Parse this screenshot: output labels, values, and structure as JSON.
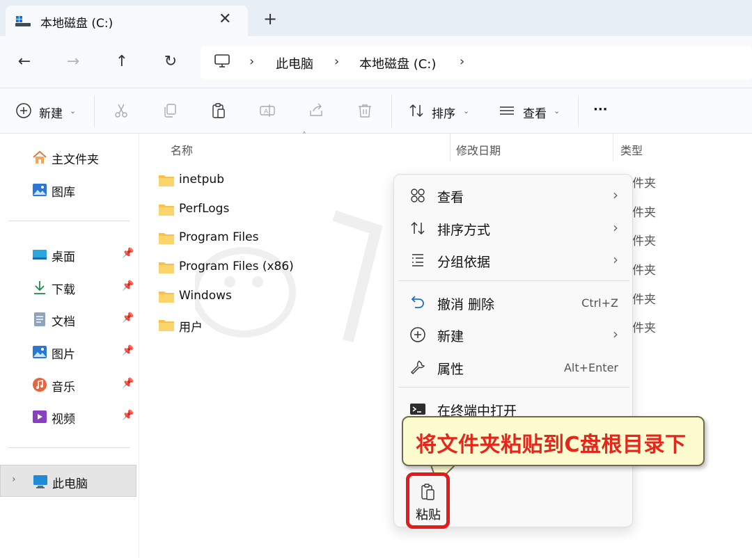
{
  "tab": {
    "title": "本地磁盘 (C:)",
    "close": "✕",
    "new_tab": "+"
  },
  "nav": {
    "back": "←",
    "forward": "→",
    "up": "↑",
    "refresh": "↻"
  },
  "address": {
    "separators": [
      "›",
      "›",
      "›"
    ],
    "crumbs": [
      "此电脑",
      "本地磁盘 (C:)"
    ]
  },
  "toolbar": {
    "new_label": "新建",
    "sort_label": "排序",
    "view_label": "查看",
    "more_label": "···",
    "chevron": "⌄"
  },
  "sidebar": {
    "top_items": [
      {
        "label": "主文件夹",
        "icon": "home-icon"
      },
      {
        "label": "图库",
        "icon": "gallery-icon"
      }
    ],
    "quick_items": [
      {
        "label": "桌面",
        "icon": "desktop-icon"
      },
      {
        "label": "下载",
        "icon": "download-icon"
      },
      {
        "label": "文档",
        "icon": "document-icon"
      },
      {
        "label": "图片",
        "icon": "pictures-icon"
      },
      {
        "label": "音乐",
        "icon": "music-icon"
      },
      {
        "label": "视频",
        "icon": "video-icon"
      }
    ],
    "pin": "📌",
    "this_pc": "此电脑",
    "expand": "›"
  },
  "columns": {
    "name": "名称",
    "modified": "修改日期",
    "type": "类型",
    "sort_caret": "˄"
  },
  "files": [
    {
      "name": "inetpub",
      "type": "件夹"
    },
    {
      "name": "PerfLogs",
      "type": "件夹"
    },
    {
      "name": "Program Files",
      "type": "件夹"
    },
    {
      "name": "Program Files (x86)",
      "type": "件夹"
    },
    {
      "name": "Windows",
      "type": "件夹"
    },
    {
      "name": "用户",
      "type": "件夹"
    }
  ],
  "context_menu": {
    "items": [
      {
        "label": "查看",
        "shortcut": "",
        "submenu": true,
        "icon": "grid-icon"
      },
      {
        "label": "排序方式",
        "shortcut": "",
        "submenu": true,
        "icon": "sort-icon"
      },
      {
        "label": "分组依据",
        "shortcut": "",
        "submenu": true,
        "icon": "group-icon"
      },
      {
        "label": "撤消 删除",
        "shortcut": "Ctrl+Z",
        "submenu": false,
        "icon": "undo-icon"
      },
      {
        "label": "新建",
        "shortcut": "",
        "submenu": true,
        "icon": "plus-circle-icon"
      },
      {
        "label": "属性",
        "shortcut": "Alt+Enter",
        "submenu": false,
        "icon": "wrench-icon"
      },
      {
        "label": "在终端中打开",
        "shortcut": "",
        "submenu": false,
        "icon": "terminal-icon"
      }
    ],
    "chevron": "›",
    "paste_label": "粘贴"
  },
  "callout": {
    "text": "将文件夹粘贴到C盘根目录下"
  },
  "colors": {
    "accent": "#0067c0",
    "highlight_red": "#e31b1b",
    "callout_bg": "#fdfccf",
    "folder": "#f8c24a"
  }
}
